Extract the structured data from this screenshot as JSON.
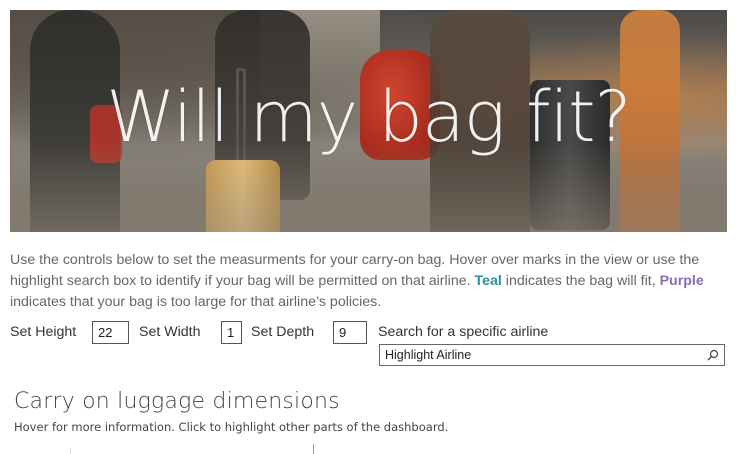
{
  "hero": {
    "title": "Will my bag fit?"
  },
  "intro": {
    "part1": "Use the controls below to set the measurments for your carry-on bag. Hover over marks in the view or use the highlight search box to identify if your bag will be permitted on that airline. ",
    "teal_word": "Teal",
    "part2": " indicates the bag will fit, ",
    "purple_word": "Purple",
    "part3": " indicates that your bag is too large for that airline’s policies.",
    "teal_color": "#2a8f9e",
    "purple_color": "#8a6fb0"
  },
  "controls": {
    "height_label": "Set Height",
    "height_value": "22",
    "width_label": "Set Width",
    "width_value": "1",
    "depth_label": "Set Depth",
    "depth_value": "9",
    "search_label": "Search for a specific airline",
    "search_placeholder": "Highlight Airline",
    "search_icon": "search-icon"
  },
  "section": {
    "title": "Carry on luggage dimensions",
    "subtitle": "Hover for more information. Click to highlight other parts of the dashboard."
  }
}
